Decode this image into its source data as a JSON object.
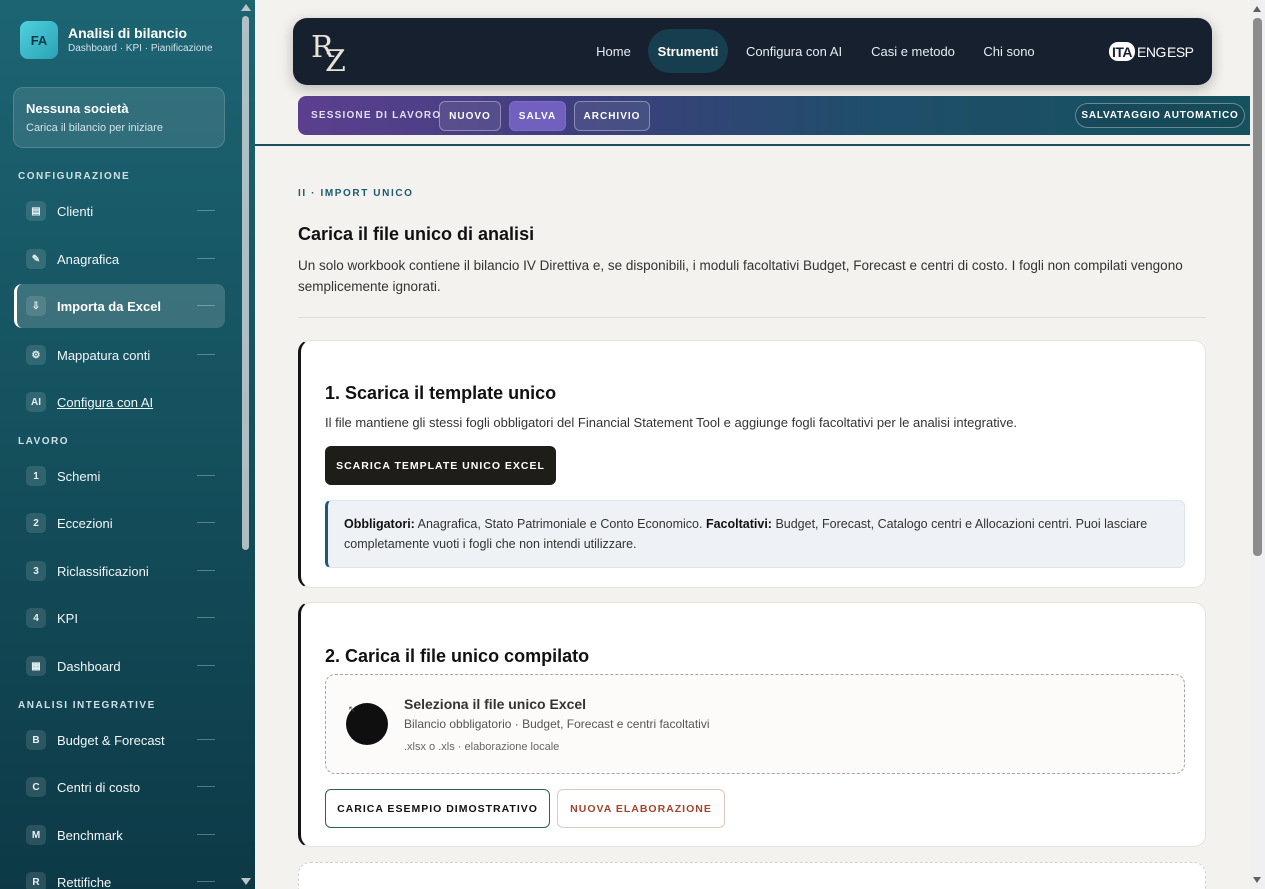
{
  "sidebar": {
    "brand": {
      "initials": "FA",
      "title": "Analisi di bilancio",
      "subtitle": "Dashboard · KPI · Pianificazione"
    },
    "company": {
      "title": "Nessuna società",
      "subtitle": "Carica il bilancio per iniziare"
    },
    "sections": {
      "config": "CONFIGURAZIONE",
      "work": "LAVORO",
      "integrative": "ANALISI INTEGRATIVE"
    },
    "config_items": [
      {
        "badge": "▤",
        "label": "Clienti"
      },
      {
        "badge": "✎",
        "label": "Anagrafica"
      },
      {
        "badge": "⇩",
        "label": "Importa da Excel"
      },
      {
        "badge": "⚙",
        "label": "Mappatura conti"
      },
      {
        "badge": "AI",
        "label": "Configura con AI"
      }
    ],
    "work_items": [
      {
        "badge": "1",
        "label": "Schemi"
      },
      {
        "badge": "2",
        "label": "Eccezioni"
      },
      {
        "badge": "3",
        "label": "Riclassificazioni"
      },
      {
        "badge": "4",
        "label": "KPI"
      },
      {
        "badge": "▦",
        "label": "Dashboard"
      }
    ],
    "integrative_items": [
      {
        "badge": "B",
        "label": "Budget & Forecast"
      },
      {
        "badge": "C",
        "label": "Centri di costo"
      },
      {
        "badge": "M",
        "label": "Benchmark"
      },
      {
        "badge": "R",
        "label": "Rettifiche"
      }
    ]
  },
  "topnav": {
    "logo_r": "R",
    "logo_z": "Z",
    "menu": [
      "Home",
      "Strumenti",
      "Configura con AI",
      "Casi e metodo",
      "Chi sono"
    ],
    "languages": [
      "ITA",
      "ENG",
      "ESP"
    ]
  },
  "session": {
    "label": "SESSIONE DI LAVORO",
    "buttons": [
      "NUOVO",
      "SALVA",
      "ARCHIVIO"
    ],
    "autosave": "SALVATAGGIO AUTOMATICO"
  },
  "main": {
    "eyebrow": "II · IMPORT UNICO",
    "title": "Carica il file unico di analisi",
    "lead": "Un solo workbook contiene il bilancio IV Direttiva e, se disponibili, i moduli facoltativi Budget, Forecast e centri di costo. I fogli non compilati vengono semplicemente ignorati."
  },
  "step1": {
    "title": "1. Scarica il template unico",
    "text": "Il file mantiene gli stessi fogli obbligatori del Financial Statement Tool e aggiunge fogli facoltativi per le analisi integrative.",
    "button": "SCARICA TEMPLATE UNICO EXCEL",
    "info_label_required": "Obbligatori:",
    "info_required": " Anagrafica, Stato Patrimoniale e Conto Economico. ",
    "info_label_optional": "Facoltativi:",
    "info_optional": " Budget, Forecast, Catalogo centri e Allocazioni centri. Puoi lasciare completamente vuoti i fogli che non intendi utilizzare."
  },
  "step2": {
    "title": "2. Carica il file unico compilato",
    "drop_title": "Seleziona il file unico Excel",
    "drop_sub": "Bilancio obbligatorio · Budget, Forecast e centri facoltativi",
    "drop_ext": ".xlsx o .xls · elaborazione locale",
    "demo_button": "CARICA ESEMPIO DIMOSTRATIVO",
    "new_button": "NUOVA ELABORAZIONE"
  }
}
